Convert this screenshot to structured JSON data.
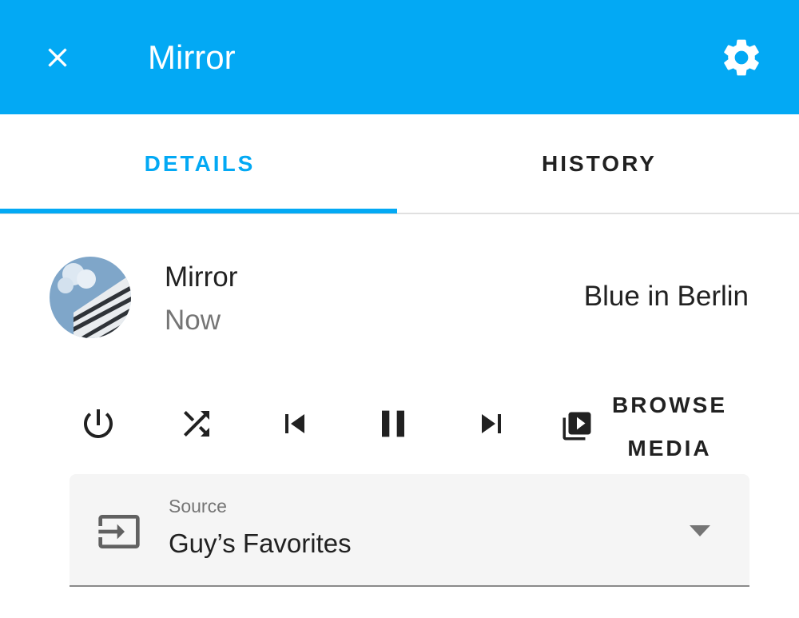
{
  "header": {
    "title": "Mirror",
    "close_icon": "close-icon",
    "settings_icon": "gear-icon"
  },
  "tabs": [
    {
      "label": "DETAILS",
      "active": true
    },
    {
      "label": "HISTORY",
      "active": false
    }
  ],
  "media": {
    "entity_name": "Mirror",
    "time": "Now",
    "title": "Blue in Berlin",
    "artwork": "building-artwork"
  },
  "controls": {
    "icons": [
      "power-icon",
      "shuffle-icon",
      "skip-previous-icon",
      "pause-icon",
      "skip-next-icon",
      "play-box-multiple-icon"
    ],
    "browse_line1": "BROWSE",
    "browse_line2": "MEDIA"
  },
  "source": {
    "label": "Source",
    "value": "Guy’s Favorites",
    "icon": "input-icon"
  },
  "colors": {
    "accent": "#03a9f4",
    "text_primary": "#212121",
    "text_secondary": "#757575"
  }
}
